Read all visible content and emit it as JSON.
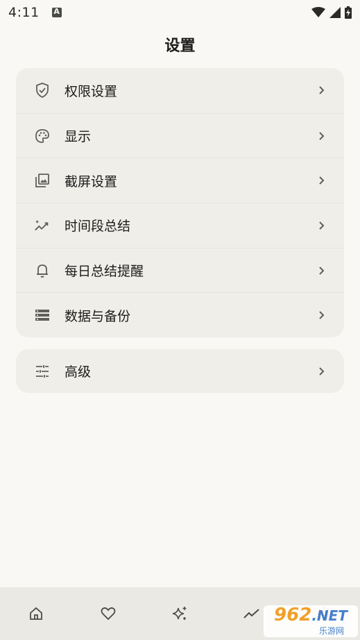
{
  "status_bar": {
    "time": "4:11",
    "icons": [
      "accessibility-a-icon",
      "wifi-icon",
      "signal-icon",
      "battery-charging-icon"
    ]
  },
  "header": {
    "title": "设置"
  },
  "settings_main": {
    "items": [
      {
        "label": "权限设置",
        "icon": "shield-check-icon"
      },
      {
        "label": "显示",
        "icon": "palette-icon"
      },
      {
        "label": "截屏设置",
        "icon": "gallery-icon"
      },
      {
        "label": "时间段总结",
        "icon": "sparkle-trend-icon"
      },
      {
        "label": "每日总结提醒",
        "icon": "bell-icon"
      },
      {
        "label": "数据与备份",
        "icon": "storage-icon"
      }
    ]
  },
  "settings_advanced": {
    "items": [
      {
        "label": "高级",
        "icon": "tune-icon"
      }
    ]
  },
  "bottom_nav": {
    "items": [
      {
        "icon": "home-icon"
      },
      {
        "icon": "heart-icon"
      },
      {
        "icon": "sparkles-icon"
      },
      {
        "icon": "trend-icon"
      },
      {
        "icon": "settings-icon"
      }
    ]
  },
  "watermark": {
    "brand": "962",
    "suffix": ".NET",
    "subtitle": "乐游网"
  },
  "colors": {
    "background": "#f9f8f4",
    "card": "#f0eee9",
    "nav": "#ebe9e4",
    "text": "#1c1b1a",
    "icon": "#5f5e5a"
  }
}
